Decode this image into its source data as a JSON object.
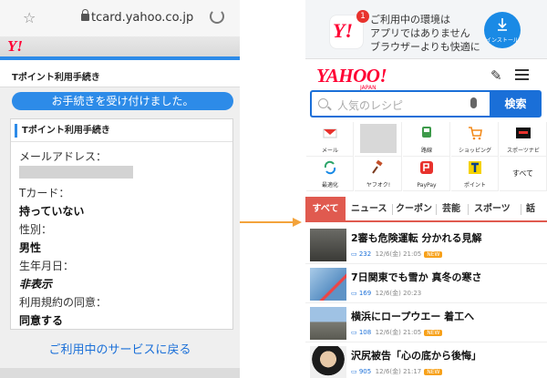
{
  "left": {
    "url": "tcard.yahoo.co.jp",
    "logo": "Y!",
    "header_title": "Tポイント利用手続き",
    "notice": "お手続きを受け付けました。",
    "card": {
      "title": "Tポイント利用手続き",
      "fields": [
        {
          "label": "メールアドレス：",
          "value": ""
        },
        {
          "label": "Tカード：",
          "value": "持っていない"
        },
        {
          "label": "性別：",
          "value": "男性"
        },
        {
          "label": "生年月日：",
          "value": "非表示"
        },
        {
          "label": "利用規約の同意：",
          "value": "同意する"
        }
      ]
    },
    "back_link": "ご利用中のサービスに戻る"
  },
  "right": {
    "banner": {
      "app_logo": "Y!",
      "badge": "1",
      "lines": [
        "ご利用中の環境は",
        "アプリではありません",
        "ブラウザーよりも快適に"
      ],
      "install_label": "インストール"
    },
    "logo": "YAHOO!",
    "logo_sub": "JAPAN",
    "search": {
      "placeholder": "人気のレシピ",
      "button": "検索"
    },
    "services": [
      {
        "label": "メール",
        "icon": "mail-icon",
        "color": "#e8322d"
      },
      {
        "label": "",
        "icon": "placeholder-tile",
        "color": "#d8d8d8"
      },
      {
        "label": "路線",
        "icon": "train-icon",
        "color": "#3d9a4a"
      },
      {
        "label": "ショッピング",
        "icon": "cart-icon",
        "color": "#f28a1b"
      },
      {
        "label": "スポーツナビ",
        "icon": "sportsnavi-icon",
        "color": "#111111"
      },
      {
        "label": "最適化",
        "icon": "optimize-icon",
        "color": "#2ca46a"
      },
      {
        "label": "ヤフオク!",
        "icon": "auction-icon",
        "color": "#c3502a"
      },
      {
        "label": "PayPay",
        "icon": "paypay-icon",
        "color": "#e8322d"
      },
      {
        "label": "ポイント",
        "icon": "tpoint-icon",
        "color": "#0a3f8c"
      },
      {
        "label": "すべて",
        "icon": "",
        "color": "#333333"
      }
    ],
    "tabs": [
      "すべて",
      "ニュース",
      "クーポン",
      "芸能",
      "スポーツ",
      "話"
    ],
    "news": [
      {
        "title": "2審も危険運転 分かれる見解",
        "comments": "232",
        "date": "12/6(金) 21:05",
        "new": "NEW"
      },
      {
        "title": "7日関東でも雪か 真冬の寒さ",
        "comments": "169",
        "date": "12/6(金) 20:23",
        "new": ""
      },
      {
        "title": "横浜にロープウエー 着工へ",
        "comments": "108",
        "date": "12/6(金) 21:05",
        "new": "NEW"
      },
      {
        "title": "沢尻被告「心の底から後悔」",
        "comments": "905",
        "date": "12/6(金) 21:17",
        "new": "NEW"
      }
    ]
  },
  "colors": {
    "yahoo_red": "#ff0033",
    "accent_blue": "#1a6fd8",
    "tab_red": "#e05a4f",
    "arrow": "#f3a33b"
  }
}
